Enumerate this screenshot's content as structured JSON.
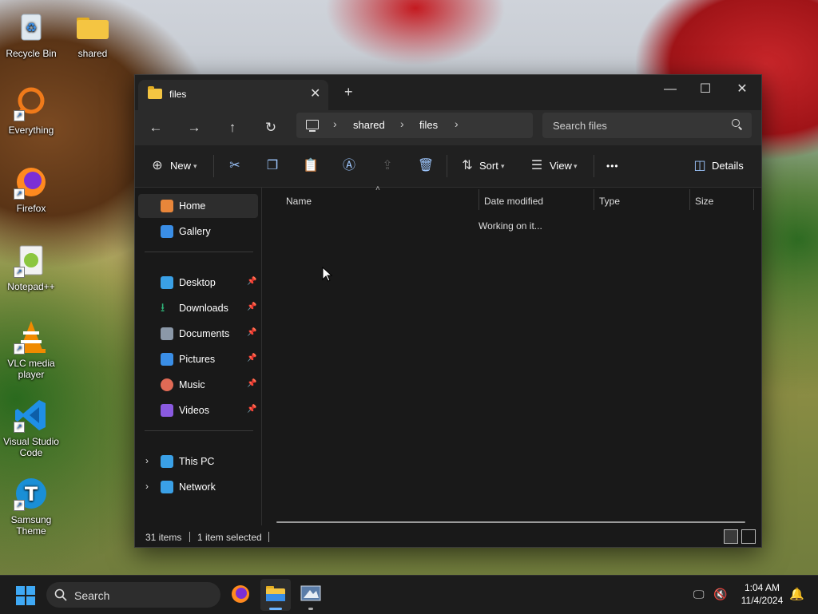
{
  "desktop": {
    "icons": [
      {
        "label": "Recycle Bin"
      },
      {
        "label": "shared"
      },
      {
        "label": "Everything"
      },
      {
        "label": "Firefox"
      },
      {
        "label": "Notepad++"
      },
      {
        "label": "VLC media player"
      },
      {
        "label": "Visual Studio Code"
      },
      {
        "label": "Samsung Theme"
      }
    ]
  },
  "window": {
    "tab_title": "files",
    "tab_close": "✕",
    "new_tab": "+",
    "controls": {
      "minimize": "—",
      "maximize": "☐",
      "close": "✕"
    },
    "nav": {
      "back": "←",
      "forward": "→",
      "up": "↑",
      "refresh": "↻"
    },
    "breadcrumb": [
      "shared",
      "files"
    ],
    "search_placeholder": "Search files",
    "toolbar": {
      "new_label": "New",
      "sort_label": "Sort",
      "view_label": "View",
      "more_label": "•••",
      "details_label": "Details"
    },
    "sidebar": {
      "top": [
        {
          "label": "Home",
          "selected": true,
          "color": "#e8863a"
        },
        {
          "label": "Gallery",
          "color": "#3a8ee6"
        }
      ],
      "pinned": [
        {
          "label": "Desktop",
          "color": "#3aa0e6"
        },
        {
          "label": "Downloads",
          "color": "#2fb67a"
        },
        {
          "label": "Documents",
          "color": "#8b98a8"
        },
        {
          "label": "Pictures",
          "color": "#3a8ee6"
        },
        {
          "label": "Music",
          "color": "#e06a55"
        },
        {
          "label": "Videos",
          "color": "#8a5ae0"
        }
      ],
      "bottom": [
        {
          "label": "This PC",
          "color": "#3aa0e6"
        },
        {
          "label": "Network",
          "color": "#3aa0e6"
        }
      ]
    },
    "columns": [
      "Name",
      "Date modified",
      "Type",
      "Size"
    ],
    "status_message": "Working on it...",
    "statusbar": {
      "items": "31 items",
      "selected": "1 item selected"
    }
  },
  "taskbar": {
    "search_label": "Search",
    "time": "1:04 AM",
    "date": "11/4/2024"
  }
}
